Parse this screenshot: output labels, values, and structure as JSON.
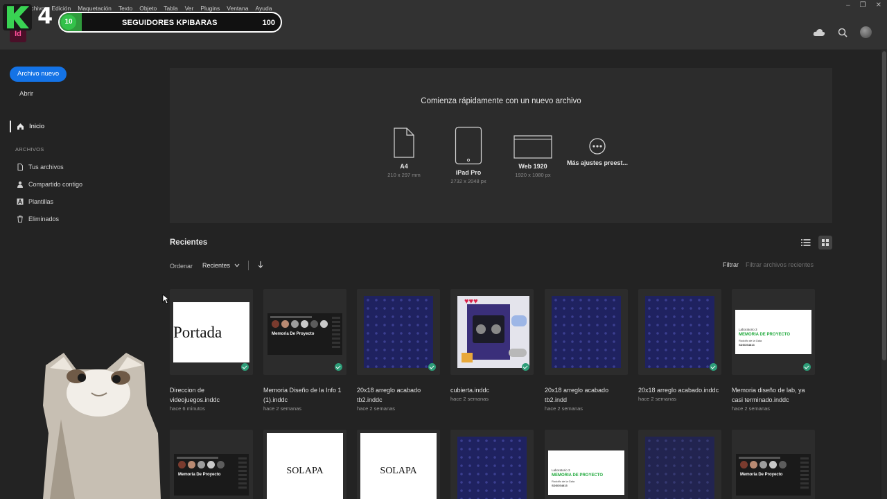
{
  "menubar": {
    "items": [
      "Archivo",
      "Edición",
      "Maquetación",
      "Texto",
      "Objeto",
      "Tabla",
      "Ver",
      "Plugins",
      "Ventana",
      "Ayuda"
    ]
  },
  "app": {
    "logo_text": "Id"
  },
  "overlay": {
    "k_number": "4",
    "followers_current": "10",
    "followers_label": "SEGUIDORES KPIBARAS",
    "followers_goal": "100",
    "progress": 0.1,
    "bar_color": "#2f9a3c"
  },
  "header_icons": [
    "cloud-icon",
    "search-icon",
    "avatar"
  ],
  "sidebar": {
    "new_file": "Archivo nuevo",
    "open": "Abrir",
    "home": "Inicio",
    "files_section": "ARCHIVOS",
    "items": [
      {
        "label": "Tus archivos",
        "icon": "document-icon"
      },
      {
        "label": "Compartido contigo",
        "icon": "user-icon"
      },
      {
        "label": "Plantillas",
        "icon": "template-icon"
      },
      {
        "label": "Eliminados",
        "icon": "trash-icon"
      }
    ]
  },
  "quick_start": {
    "title": "Comienza rápidamente con un nuevo archivo",
    "presets": [
      {
        "name": "A4",
        "dims": "210 x 297 mm"
      },
      {
        "name": "iPad Pro",
        "dims": "2732 x 2048 px"
      },
      {
        "name": "Web 1920",
        "dims": "1920 x 1080 px"
      },
      {
        "name": "Más ajustes preest...",
        "dims": ""
      }
    ]
  },
  "recents": {
    "title": "Recientes",
    "sort_label": "Ordenar",
    "sort_value": "Recientes",
    "filter_label": "Filtrar",
    "filter_placeholder": "Filtrar archivos recientes",
    "files": [
      {
        "name": "Direccion de videojuegos.inddc",
        "date": "hace 6 minutos",
        "thumb_text": "Portada"
      },
      {
        "name": "Memoria Diseño de la Info 1 (1).inddc",
        "date": "hace 2 semanas",
        "thumb_text": "Memoria De Proyecto"
      },
      {
        "name": "20x18 arreglo acabado tb2.inddc",
        "date": "hace 2 semanas"
      },
      {
        "name": "cubierta.inddc",
        "date": "hace 2 semanas"
      },
      {
        "name": "20x18 arreglo acabado tb2.indd",
        "date": "hace 2 semanas"
      },
      {
        "name": "20x18 arreglo acabado.inddc",
        "date": "hace 2 semanas"
      },
      {
        "name": "Memoria diseño de lab, ya casi terminado.inddc",
        "date": "hace 2 semanas"
      }
    ],
    "memo_thumb": {
      "line1": "Laboratorio 3",
      "line2": "MEMORIA DE PROYECTO",
      "line3": "Rodolfo de la Gala",
      "line4": "SDSDS4813"
    },
    "row2_texts": {
      "screen": "Memoria De Proyecto",
      "solapa": "SOLAPA"
    }
  }
}
